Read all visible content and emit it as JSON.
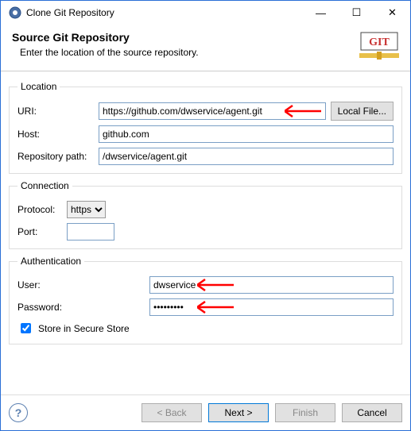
{
  "window": {
    "title": "Clone Git Repository",
    "minimize": "—",
    "maximize": "☐",
    "close": "✕"
  },
  "header": {
    "title": "Source Git Repository",
    "subtitle": "Enter the location of the source repository.",
    "git_label": "GIT"
  },
  "location": {
    "legend": "Location",
    "uri_label": "URI:",
    "uri_value": "https://github.com/dwservice/agent.git",
    "local_file_label": "Local File...",
    "host_label": "Host:",
    "host_value": "github.com",
    "repo_label": "Repository path:",
    "repo_value": "/dwservice/agent.git"
  },
  "connection": {
    "legend": "Connection",
    "protocol_label": "Protocol:",
    "protocol_value": "https",
    "port_label": "Port:",
    "port_value": ""
  },
  "auth": {
    "legend": "Authentication",
    "user_label": "User:",
    "user_value": "dwservice",
    "password_label": "Password:",
    "password_value": "•••••••••",
    "store_label": "Store in Secure Store"
  },
  "footer": {
    "help": "?",
    "back": "< Back",
    "next": "Next >",
    "finish": "Finish",
    "cancel": "Cancel"
  }
}
